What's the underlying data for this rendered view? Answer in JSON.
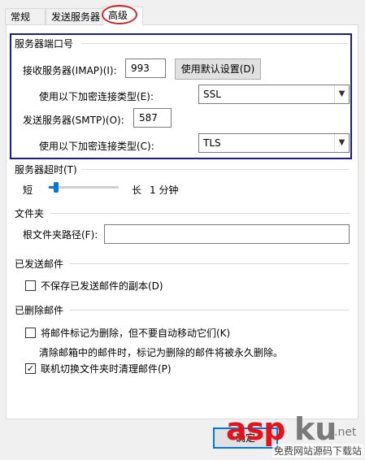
{
  "tabs": [
    {
      "label": "常规",
      "active": false
    },
    {
      "label": "发送服务器",
      "active": false
    },
    {
      "label": "高级",
      "active": true
    }
  ],
  "server_ports": {
    "title": "服务器端口号",
    "imap_label": "接收服务器(IMAP)(I):",
    "imap_value": "993",
    "default_button": "使用默认设置(D)",
    "encrypt_label_1": "使用以下加密连接类型(E):",
    "encrypt_value_1": "SSL",
    "smtp_label": "发送服务器(SMTP)(O):",
    "smtp_value": "587",
    "encrypt_label_2": "使用以下加密连接类型(C):",
    "encrypt_value_2": "TLS"
  },
  "timeout": {
    "title": "服务器超时(T)",
    "short_label": "短",
    "long_label": "长",
    "value_text": "1 分钟",
    "level": 0.08
  },
  "folders": {
    "title": "文件夹",
    "root_label": "根文件夹路径(F):",
    "root_value": ""
  },
  "sent": {
    "title": "已发送邮件",
    "no_copy_label": "不保存已发送邮件的副本(D)",
    "no_copy_checked": false
  },
  "deleted": {
    "title": "已删除邮件",
    "mark_label": "将邮件标记为删除，但不要自动移动它们(K)",
    "mark_checked": false,
    "note": "清除邮箱中的邮件时，标记为删除的邮件将被永久删除。",
    "purge_label": "联机切换文件夹时清理邮件(P)",
    "purge_checked": true
  },
  "footer": {
    "ok_label": "确定"
  },
  "watermark": {
    "asp": "asp",
    "ku": "ku",
    "net": ".net",
    "sub": "免费网站源码下载站"
  },
  "colors": {
    "highlight_border": "#1c1c8c",
    "tab_oval": "#d2232a",
    "accent": "#0078d7"
  }
}
